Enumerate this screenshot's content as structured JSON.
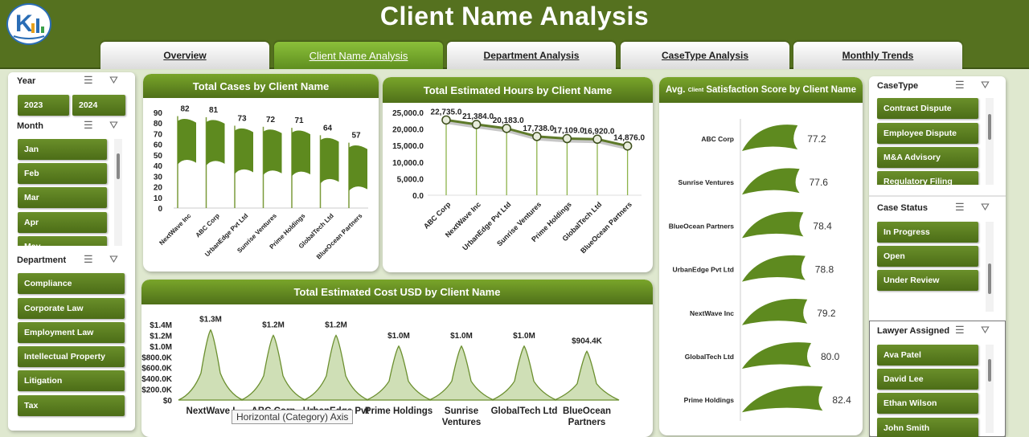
{
  "header": {
    "title": "Client Name Analysis"
  },
  "tabs": [
    {
      "label": "Overview",
      "active": false
    },
    {
      "label": "Client Name Analysis",
      "active": true
    },
    {
      "label": "Department Analysis",
      "active": false
    },
    {
      "label": "CaseType Analysis",
      "active": false
    },
    {
      "label": "Monthly Trends",
      "active": false
    }
  ],
  "slicers": {
    "year": {
      "title": "Year",
      "items": [
        "2023",
        "2024"
      ]
    },
    "month": {
      "title": "Month",
      "items": [
        "Jan",
        "Feb",
        "Mar",
        "Apr",
        "May"
      ]
    },
    "department": {
      "title": "Department",
      "items": [
        "Compliance",
        "Corporate Law",
        "Employment Law",
        "Intellectual Property",
        "Litigation",
        "Tax"
      ]
    },
    "casetype": {
      "title": "CaseType",
      "items": [
        "Contract Dispute",
        "Employee Dispute",
        "M&A Advisory",
        "Regulatory Filing"
      ]
    },
    "casestatus": {
      "title": "Case Status",
      "items": [
        "In Progress",
        "Open",
        "Under Review"
      ]
    },
    "lawyer": {
      "title": "Lawyer Assigned",
      "items": [
        "Ava Patel",
        "David Lee",
        "Ethan Wilson",
        "John Smith"
      ]
    }
  },
  "tooltip": "Horizontal (Category) Axis",
  "chart_data": [
    {
      "type": "bar",
      "title": "Total Cases by Client Name",
      "categories": [
        "NextWave Inc",
        "ABC Corp",
        "UrbanEdge Pvt Ltd",
        "Sunrise Ventures",
        "Prime Holdings",
        "GlobalTech Ltd",
        "BlueOcean Partners"
      ],
      "values": [
        82,
        81,
        73,
        72,
        71,
        64,
        57
      ],
      "yticks": [
        "90",
        "80",
        "70",
        "60",
        "50",
        "40",
        "30",
        "20",
        "10",
        "0"
      ],
      "ylim": [
        0,
        90
      ]
    },
    {
      "type": "line",
      "title": "Total Estimated Hours by Client Name",
      "categories": [
        "ABC Corp",
        "NextWave Inc",
        "UrbanEdge Pvt Ltd",
        "Sunrise Ventures",
        "Prime Holdings",
        "GlobalTech Ltd",
        "BlueOcean Partners"
      ],
      "values": [
        22735,
        21384,
        20183,
        17738,
        17109,
        16920,
        14876
      ],
      "labels": [
        "22,735.0",
        "21,384.0",
        "20,183.0",
        "17,738.0",
        "17,109.0",
        "16,920.0",
        "14,876.0"
      ],
      "yticks": [
        "25,000.0",
        "20,000.0",
        "15,000.0",
        "10,000.0",
        "5,000.0",
        "0.0"
      ],
      "ylim": [
        0,
        25000
      ]
    },
    {
      "type": "bar",
      "title": "Avg. Client Satisfaction Score by Client Name",
      "title_prefix": "Avg.",
      "title_small": "Client",
      "title_suffix": "Satisfaction Score by Client Name",
      "categories": [
        "ABC Corp",
        "Sunrise Ventures",
        "BlueOcean Partners",
        "UrbanEdge Pvt Ltd",
        "NextWave Inc",
        "GlobalTech Ltd",
        "Prime Holdings"
      ],
      "values": [
        77.2,
        77.6,
        78.4,
        78.8,
        79.2,
        80.0,
        82.4
      ],
      "labels": [
        "77.2",
        "77.6",
        "78.4",
        "78.8",
        "79.2",
        "80.0",
        "82.4"
      ]
    },
    {
      "type": "area",
      "title": "Total Estimated Cost USD by Client Name",
      "categories": [
        "NextWave Inc",
        "ABC Corp",
        "UrbanEdge Pvt Ltd",
        "Prime Holdings",
        "Sunrise Ventures",
        "GlobalTech Ltd",
        "BlueOcean Partners"
      ],
      "category_display": [
        [
          "NextWave I"
        ],
        [
          "ABC Corp"
        ],
        [
          "UrbanEdge Pvt"
        ],
        [
          "Prime Holdings"
        ],
        [
          "Sunrise",
          "Ventures"
        ],
        [
          "GlobalTech Ltd"
        ],
        [
          "BlueOcean",
          "Partners"
        ]
      ],
      "values": [
        1300000,
        1200000,
        1200000,
        1000000,
        1000000,
        1000000,
        904400
      ],
      "labels": [
        "$1.3M",
        "$1.2M",
        "$1.2M",
        "$1.0M",
        "$1.0M",
        "$1.0M",
        "$904.4K"
      ],
      "yticks": [
        "$1.4M",
        "$1.2M",
        "$1.0M",
        "$800.0K",
        "$600.0K",
        "$400.0K",
        "$200.0K",
        "$0"
      ],
      "ylim": [
        0,
        1400000
      ]
    }
  ],
  "colors": {
    "header": "#55711f",
    "accent": "#6a8f2a",
    "dark": "#4c6d17",
    "area": "#c9dbb0"
  }
}
